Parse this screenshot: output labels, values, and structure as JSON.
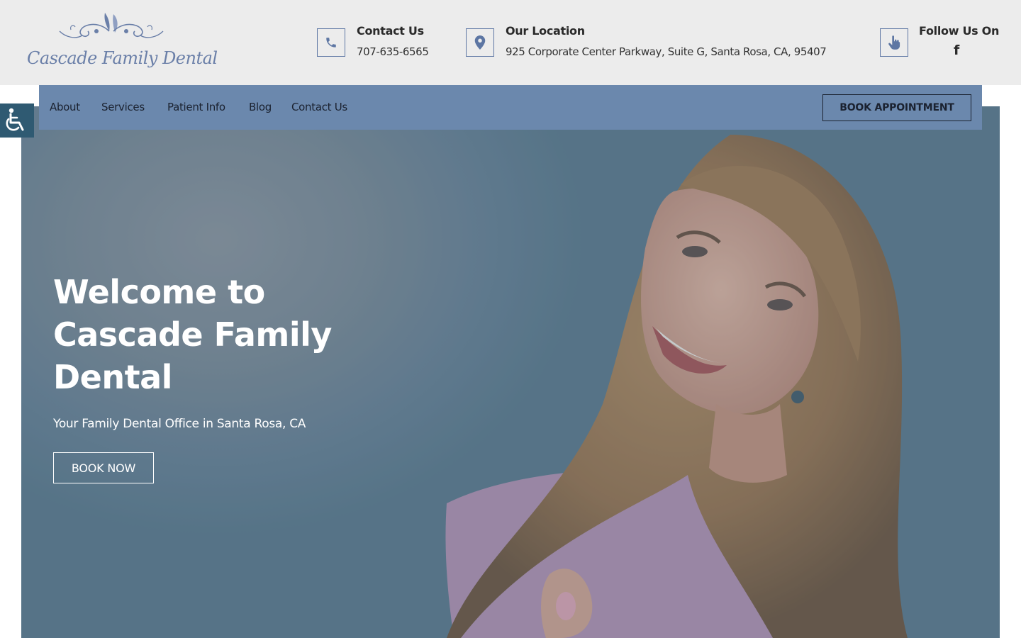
{
  "header": {
    "logo_text": "Cascade Family Dental",
    "contact": {
      "title": "Contact Us",
      "value": "707-635-6565",
      "icon": "phone-icon"
    },
    "location": {
      "title": "Our Location",
      "value": "925 Corporate Center Parkway, Suite G, Santa Rosa, CA, 95407",
      "icon": "map-pin-icon"
    },
    "follow": {
      "title": "Follow Us On",
      "icon": "hand-pointer-icon",
      "social_icon": "facebook-icon",
      "social_glyph": "f"
    }
  },
  "nav": {
    "items": [
      {
        "label": "About"
      },
      {
        "label": "Services"
      },
      {
        "label": "Patient Info"
      },
      {
        "label": "Blog"
      },
      {
        "label": "Contact Us"
      }
    ],
    "cta": "BOOK APPOINTMENT"
  },
  "hero": {
    "title": "Welcome to Cascade Family Dental",
    "subtitle": "Your Family Dental Office in Santa Rosa, CA",
    "button": "BOOK NOW"
  },
  "accessibility": {
    "icon": "wheelchair-icon"
  },
  "colors": {
    "topbar_bg": "#ececec",
    "nav_bg": "#6b88ad",
    "accent": "#5d76a3",
    "accessibility_bg": "#2f5a72"
  }
}
